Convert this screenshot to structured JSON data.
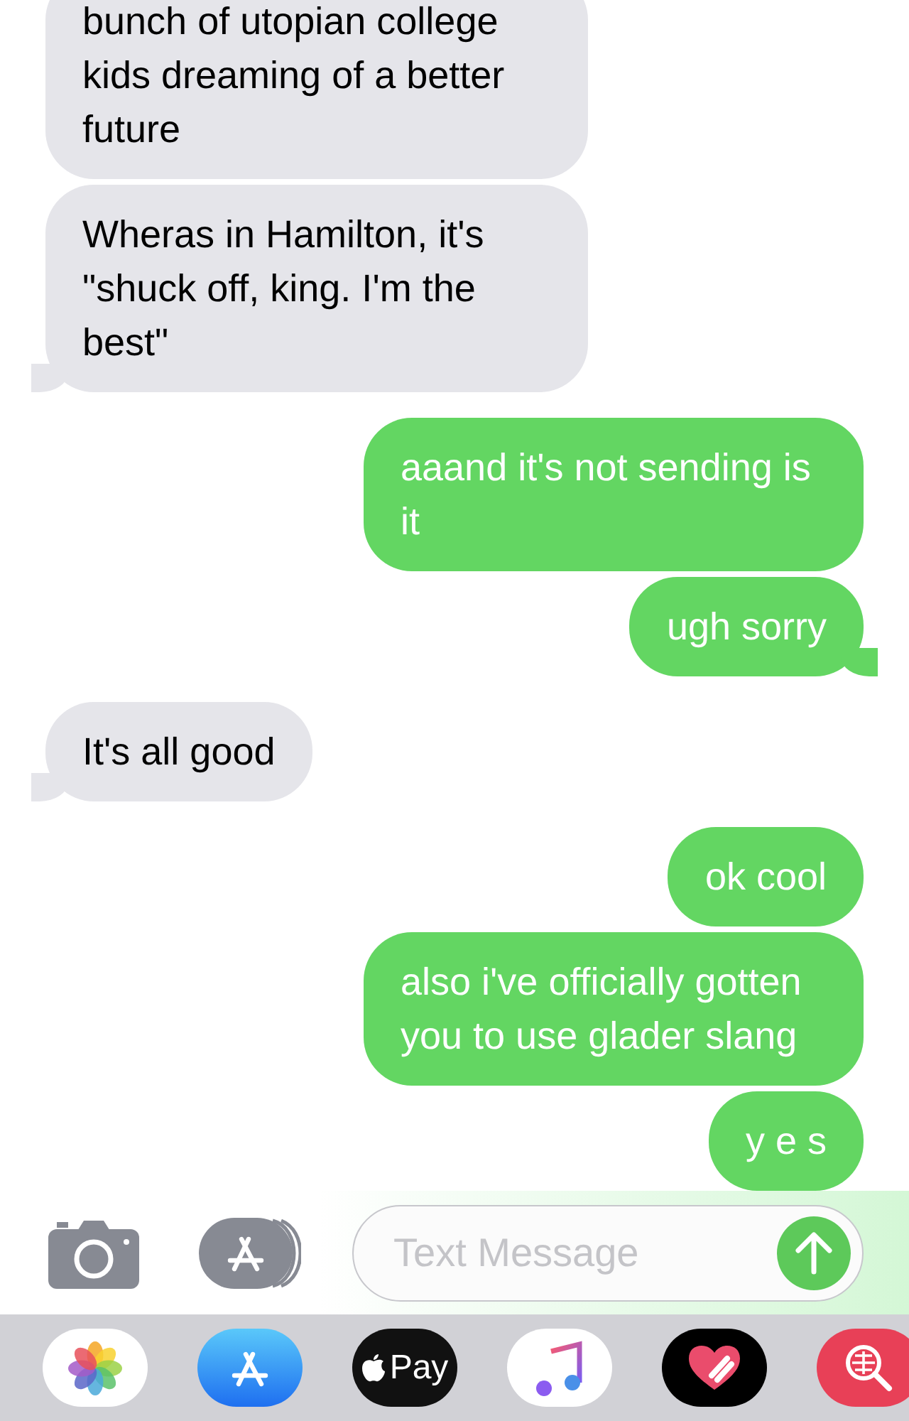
{
  "messages": [
    {
      "kind": "received",
      "text": "bunch of utopian college kids dreaming of a better future",
      "tail": false
    },
    {
      "kind": "received",
      "text": "Wheras in Hamilton, it's \"shuck off, king.  I'm the best\"",
      "tail": true
    },
    {
      "kind": "sent",
      "text": "aaand it's not sending is it",
      "tail": false
    },
    {
      "kind": "sent",
      "text": "ugh sorry",
      "tail": true
    },
    {
      "kind": "received",
      "text": "It's all good",
      "tail": true
    },
    {
      "kind": "sent",
      "text": "ok cool",
      "tail": false
    },
    {
      "kind": "sent",
      "text": "also i've officially gotten you to use glader slang",
      "tail": false
    },
    {
      "kind": "sent",
      "text": "y e s",
      "tail": false
    }
  ],
  "composer": {
    "placeholder": "Text Message"
  },
  "tray": [
    {
      "kind": "photos"
    },
    {
      "kind": "store"
    },
    {
      "kind": "pay",
      "label": "Pay"
    },
    {
      "kind": "music"
    },
    {
      "kind": "heart"
    },
    {
      "kind": "search"
    }
  ]
}
